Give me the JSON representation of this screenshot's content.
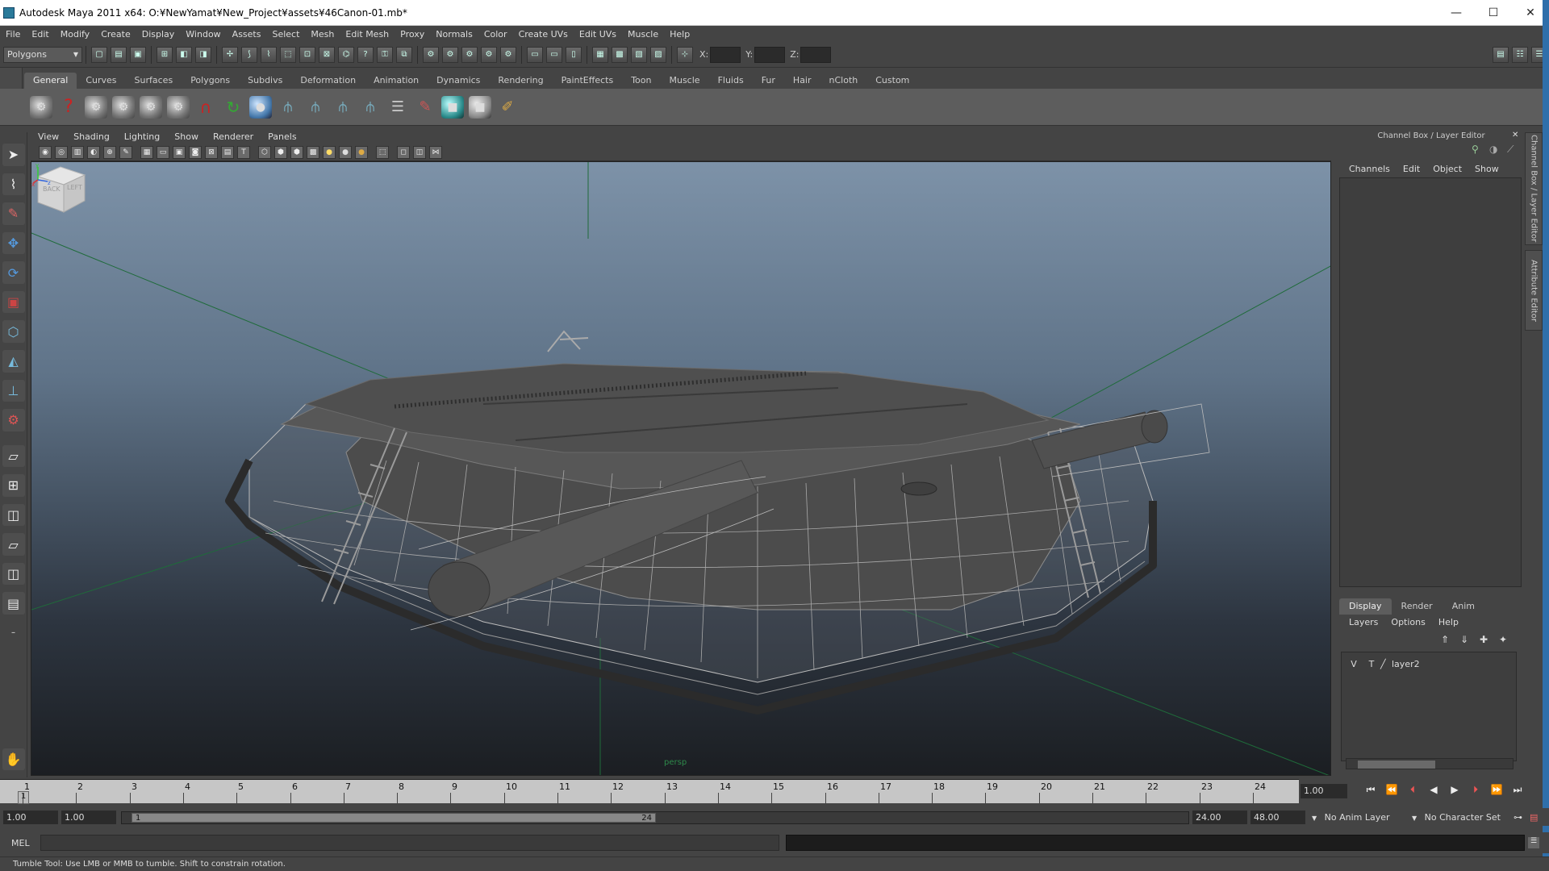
{
  "window": {
    "title": "Autodesk Maya 2011 x64: O:¥NewYamat¥New_Project¥assets¥46Canon-01.mb*",
    "minimize": "—",
    "maximize": "☐",
    "close": "✕"
  },
  "menubar": [
    "File",
    "Edit",
    "Modify",
    "Create",
    "Display",
    "Window",
    "Assets",
    "Select",
    "Mesh",
    "Edit Mesh",
    "Proxy",
    "Normals",
    "Color",
    "Create UVs",
    "Edit UVs",
    "Muscle",
    "Help"
  ],
  "statusline": {
    "mode": "Polygons",
    "x_label": "X:",
    "y_label": "Y:",
    "z_label": "Z:"
  },
  "shelf": {
    "tabs": [
      "General",
      "Curves",
      "Surfaces",
      "Polygons",
      "Subdivs",
      "Deformation",
      "Animation",
      "Dynamics",
      "Rendering",
      "PaintEffects",
      "Toon",
      "Muscle",
      "Fluids",
      "Fur",
      "Hair",
      "nCloth",
      "Custom"
    ],
    "active_tab": "General"
  },
  "viewport": {
    "menu": [
      "View",
      "Shading",
      "Lighting",
      "Show",
      "Renderer",
      "Panels"
    ],
    "camera_label": "persp",
    "viewcube_faces": [
      "BACK",
      "LEFT"
    ],
    "axis_labels": {
      "x": "x",
      "y": "y",
      "z": "z"
    }
  },
  "channel_box": {
    "title": "Channel Box / Layer Editor",
    "menu": [
      "Channels",
      "Edit",
      "Object",
      "Show"
    ],
    "side_tabs": [
      "Channel Box / Layer Editor",
      "Attribute Editor"
    ]
  },
  "layer_editor": {
    "tabs": [
      "Display",
      "Render",
      "Anim"
    ],
    "active_tab": "Display",
    "menu": [
      "Layers",
      "Options",
      "Help"
    ],
    "layers": [
      {
        "visible": "V",
        "template": "T",
        "name": "layer2"
      }
    ]
  },
  "timeline": {
    "frames": [
      "1",
      "2",
      "3",
      "4",
      "5",
      "6",
      "7",
      "8",
      "9",
      "10",
      "11",
      "12",
      "13",
      "14",
      "15",
      "16",
      "17",
      "18",
      "19",
      "20",
      "21",
      "22",
      "23",
      "24"
    ],
    "current_frame_marker": "1",
    "current_time": "1.00"
  },
  "range": {
    "start_time": "1.00",
    "playback_start": "1.00",
    "range_start": "1",
    "range_end": "24",
    "playback_end": "24.00",
    "end_time": "48.00",
    "anim_layer": "No Anim Layer",
    "character_set": "No Character Set"
  },
  "command_line": {
    "label": "MEL"
  },
  "help_line": "Tumble Tool: Use LMB or MMB to tumble. Shift to constrain rotation.",
  "colors": {
    "ui_bg": "#444444",
    "viewport_top": "#7d92a8",
    "viewport_bottom": "#1b1e22",
    "grid_axis": "#1f6b3a"
  }
}
